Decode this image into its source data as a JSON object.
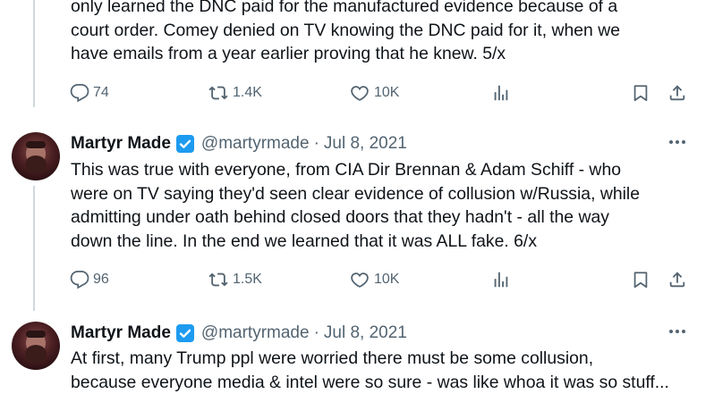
{
  "tweets": [
    {
      "text": "only learned the DNC paid for the manufactured evidence because of a\ncourt order. Comey denied on TV knowing the DNC paid for it, when we\nhave emails from a year earlier proving that he knew. 5/x",
      "replies": "74",
      "retweets": "1.4K",
      "likes": "10K"
    },
    {
      "author": "Martyr Made",
      "handle": "@martyrmade",
      "separator": "·",
      "date": "Jul 8, 2021",
      "text": "This was true with everyone, from CIA Dir Brennan & Adam Schiff - who\nwere on TV saying they'd seen clear evidence of collusion w/Russia, while\nadmitting under oath behind closed doors that they hadn't - all the way\ndown the line. In the end we learned that it was ALL fake. 6/x",
      "replies": "96",
      "retweets": "1.5K",
      "likes": "10K"
    },
    {
      "author": "Martyr Made",
      "handle": "@martyrmade",
      "separator": "·",
      "date": "Jul 8, 2021",
      "text": "At first, many Trump ppl were worried there must be some collusion,\nbecause everyone media & intel were so sure - was like whoa it was so stuff..."
    }
  ],
  "colors": {
    "muted": "#536471",
    "verified": "#1d9bf0",
    "thread_line": "#cfd9de"
  },
  "icons": [
    "reply-icon",
    "retweet-icon",
    "like-icon",
    "views-icon",
    "bookmark-icon",
    "share-icon",
    "more-icon",
    "verified-badge-icon"
  ]
}
